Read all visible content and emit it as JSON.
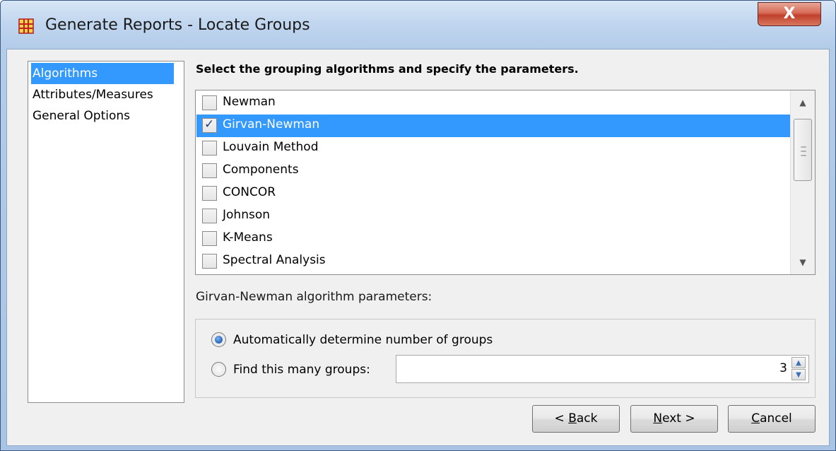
{
  "window": {
    "title": "Generate Reports - Locate Groups",
    "app_icon": "network-grid-icon",
    "close_glyph": "X",
    "accent": "#3399ff"
  },
  "nav": {
    "items": [
      {
        "label": "Algorithms",
        "selected": true
      },
      {
        "label": "Attributes/Measures",
        "selected": false
      },
      {
        "label": "General Options",
        "selected": false
      }
    ]
  },
  "main": {
    "heading": "Select the grouping algorithms and specify the parameters.",
    "algorithms": [
      {
        "label": "Newman",
        "checked": false
      },
      {
        "label": "Girvan-Newman",
        "checked": true
      },
      {
        "label": "Louvain Method",
        "checked": false
      },
      {
        "label": "Components",
        "checked": false
      },
      {
        "label": "CONCOR",
        "checked": false
      },
      {
        "label": "Johnson",
        "checked": false
      },
      {
        "label": "K-Means",
        "checked": false
      },
      {
        "label": "Spectral Analysis",
        "checked": false
      }
    ],
    "params_label": "Girvan-Newman algorithm parameters:",
    "radio_auto": "Automatically determine number of groups",
    "radio_find": "Find this many groups:",
    "selected_radio": "auto",
    "group_count": "3"
  },
  "buttons": {
    "back_prefix": "< ",
    "back_key": "B",
    "back_rest": "ack",
    "next_key": "N",
    "next_rest": "ext >",
    "cancel_key": "C",
    "cancel_rest": "ancel"
  }
}
